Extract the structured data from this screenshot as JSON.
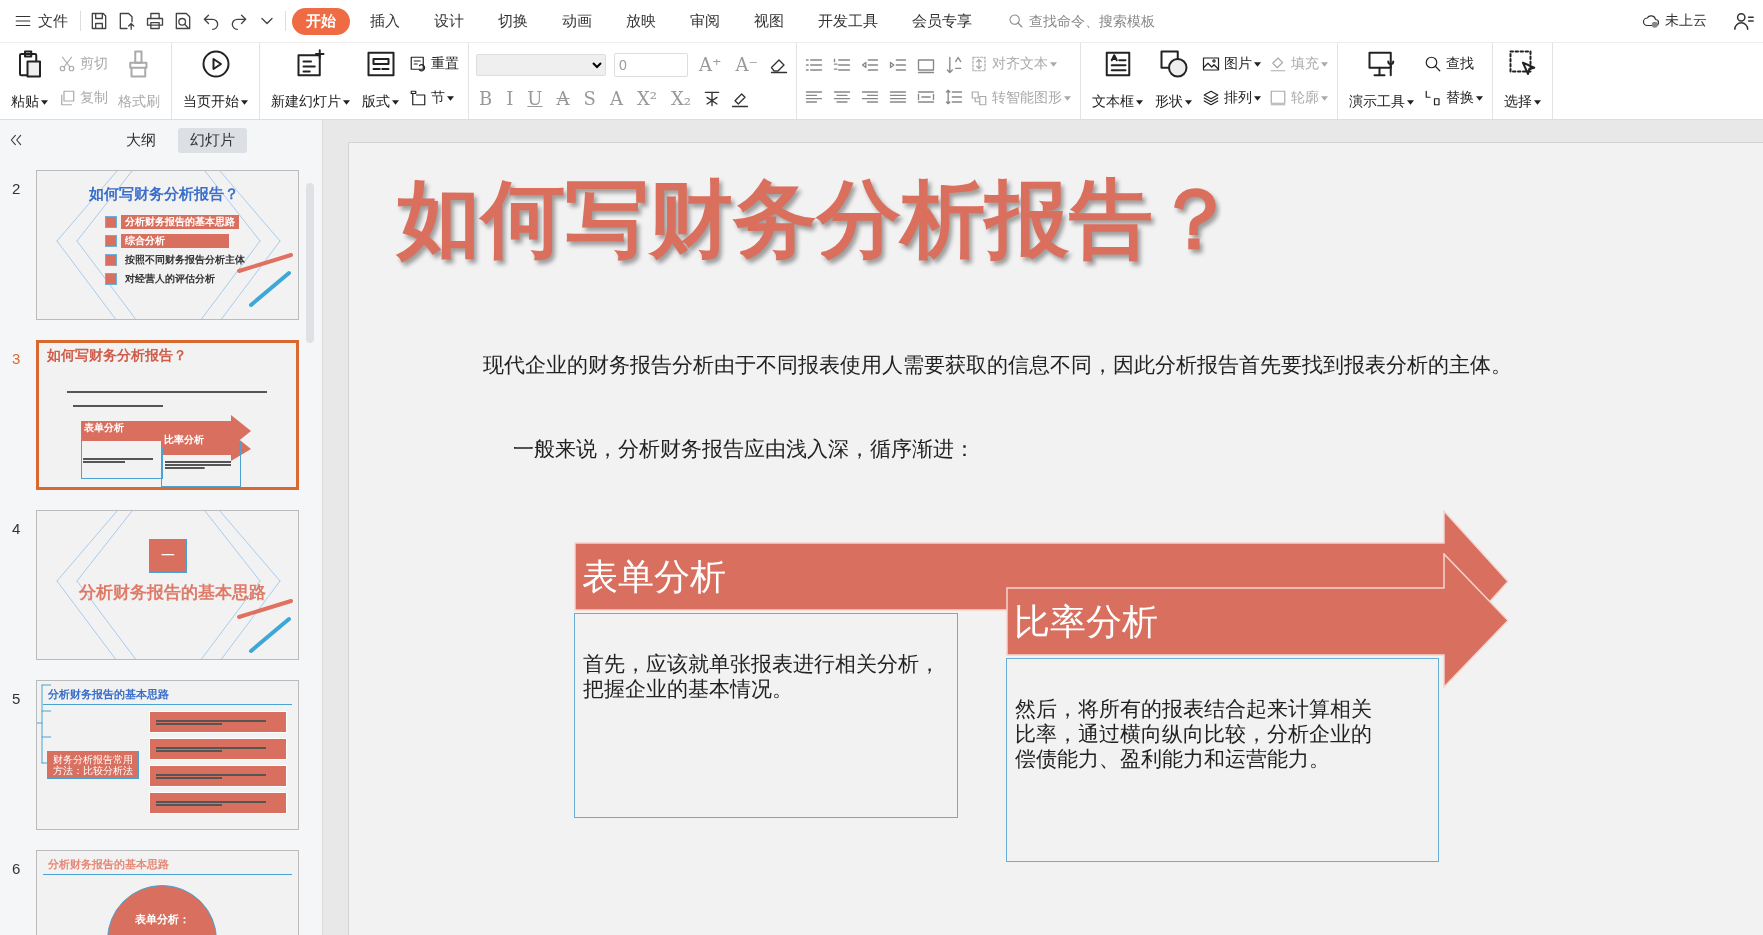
{
  "menu": {
    "label": "文件"
  },
  "tabs": [
    {
      "label": "开始",
      "selected": true
    },
    {
      "label": "插入",
      "selected": false
    },
    {
      "label": "设计",
      "selected": false
    },
    {
      "label": "切换",
      "selected": false
    },
    {
      "label": "动画",
      "selected": false
    },
    {
      "label": "放映",
      "selected": false
    },
    {
      "label": "审阅",
      "selected": false
    },
    {
      "label": "视图",
      "selected": false
    },
    {
      "label": "开发工具",
      "selected": false
    },
    {
      "label": "会员专享",
      "selected": false
    }
  ],
  "search": {
    "placeholder": "查找命令、搜索模板"
  },
  "cloud": {
    "label": "未上云"
  },
  "ribbon": [
    {
      "items": [
        {
          "kind": "large",
          "label": "粘贴",
          "dropdown": true,
          "disabled": false
        },
        {
          "kind": "stack",
          "items": [
            {
              "label": "剪切",
              "dropdown": false,
              "disabled": true
            },
            {
              "label": "复制",
              "dropdown": false,
              "disabled": true
            }
          ]
        },
        {
          "kind": "large",
          "label": "格式刷",
          "dropdown": false,
          "disabled": true
        }
      ]
    },
    {
      "items": [
        {
          "kind": "large",
          "label": "当页开始",
          "dropdown": true,
          "disabled": false
        }
      ]
    },
    {
      "items": [
        {
          "kind": "large",
          "label": "新建幻灯片",
          "dropdown": true,
          "disabled": false
        },
        {
          "kind": "large",
          "label": "版式",
          "dropdown": true,
          "disabled": false
        },
        {
          "kind": "stack",
          "items": [
            {
              "label": "重置",
              "dropdown": false,
              "disabled": false
            },
            {
              "label": "节",
              "dropdown": true,
              "disabled": false
            }
          ]
        }
      ]
    },
    {
      "items": [
        {
          "kind": "font",
          "size": "0",
          "size_buttons": [
            "A⁺",
            "A⁻"
          ],
          "format_buttons": [
            "B",
            "I",
            "U",
            "A",
            "S",
            "A",
            "X²",
            "X₂"
          ]
        }
      ]
    },
    {
      "items": [
        {
          "kind": "paragraph"
        },
        {
          "kind": "stack",
          "items": [
            {
              "label": "对齐文本",
              "dropdown": true,
              "disabled": true
            },
            {
              "label": "转智能图形",
              "dropdown": true,
              "disabled": true
            }
          ]
        }
      ]
    },
    {
      "items": [
        {
          "kind": "large",
          "label": "文本框",
          "dropdown": true,
          "disabled": false
        },
        {
          "kind": "large",
          "label": "形状",
          "dropdown": true,
          "disabled": false
        },
        {
          "kind": "stack",
          "items": [
            {
              "label": "图片",
              "dropdown": true,
              "disabled": false
            },
            {
              "label": "排列",
              "dropdown": true,
              "disabled": false
            }
          ]
        },
        {
          "kind": "stack",
          "items": [
            {
              "label": "填充",
              "dropdown": true,
              "disabled": true
            },
            {
              "label": "轮廓",
              "dropdown": true,
              "disabled": true
            }
          ]
        }
      ]
    },
    {
      "items": [
        {
          "kind": "large",
          "label": "演示工具",
          "dropdown": true,
          "disabled": false
        },
        {
          "kind": "stack",
          "items": [
            {
              "label": "查找",
              "dropdown": false,
              "disabled": false
            },
            {
              "label": "替换",
              "dropdown": true,
              "disabled": false
            }
          ]
        }
      ]
    },
    {
      "items": [
        {
          "kind": "large",
          "label": "选择",
          "dropdown": true,
          "disabled": false
        }
      ]
    }
  ],
  "panel": {
    "tabs": [
      {
        "label": "大纲",
        "selected": false
      },
      {
        "label": "幻灯片",
        "selected": true
      }
    ],
    "slides": [
      {
        "number": "2",
        "selected": false,
        "kind": "agenda",
        "title": "如何写财务分析报告？",
        "items": [
          {
            "text": "分析财务报告的基本思路",
            "highlighted": true
          },
          {
            "text": "综合分析",
            "highlighted": true
          },
          {
            "text": "按照不同财务报告分析主体",
            "highlighted": false
          },
          {
            "text": "对经营人的评估分析",
            "highlighted": false
          }
        ]
      },
      {
        "number": "3",
        "selected": true,
        "kind": "content",
        "title": "如何写财务分析报告？",
        "labels": [
          "表单分析",
          "比率分析"
        ]
      },
      {
        "number": "4",
        "selected": false,
        "kind": "section",
        "badge": "一",
        "title": "分析财务报告的基本思路"
      },
      {
        "number": "5",
        "selected": false,
        "kind": "diagram",
        "title": "分析财务报告的基本思路",
        "center": "财务分析报告常用方法：比较分析法"
      },
      {
        "number": "6",
        "selected": false,
        "kind": "circle",
        "title": "分析财务报告的基本思路",
        "center": "表单分析："
      }
    ]
  },
  "slide": {
    "title": "如何写财务分析报告？",
    "paragraphs": [
      "现代企业的财务报告分析由于不同报表使用人需要获取的信息不同，因此分析报告首先要找到报表分析的主体。",
      "一般来说，分析财务报告应由浅入深，循序渐进："
    ],
    "steps": [
      {
        "label": "表单分析",
        "body": "首先，应该就单张报表进行相关分析，把握企业的基本情况。"
      },
      {
        "label": "比率分析",
        "body": "然后，将所有的报表结合起来计算相关比率，通过横向纵向比较，分析企业的偿债能力、盈利能力和运营能力。"
      }
    ]
  }
}
